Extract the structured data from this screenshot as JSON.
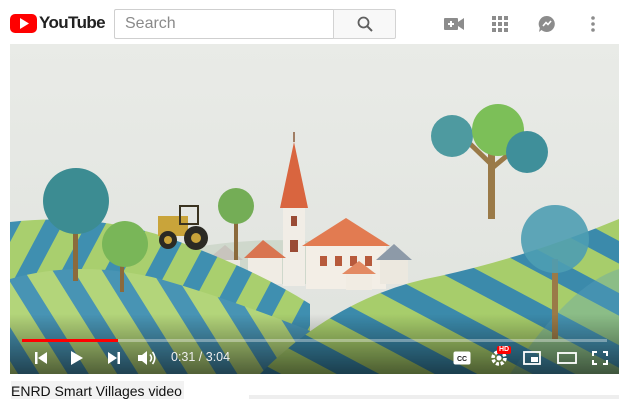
{
  "header": {
    "logo_text": "YouTube",
    "search_placeholder": "Search",
    "icons": [
      "search-icon",
      "create-video-icon",
      "apps-grid-icon",
      "messages-icon",
      "more-options-icon"
    ]
  },
  "player": {
    "progress_fraction": 0.164,
    "current_time": "0:31",
    "time_separator": "/",
    "duration": "3:04",
    "time_display": "0:31 / 3:04",
    "quality_badge": "HD",
    "icons": [
      "previous-icon",
      "play-icon",
      "next-icon",
      "volume-icon",
      "captions-icon",
      "settings-icon",
      "miniplayer-icon",
      "theater-mode-icon",
      "fullscreen-icon"
    ]
  },
  "video": {
    "title": "ENRD Smart Villages video"
  },
  "colors": {
    "brand_red": "#ff0000",
    "sky": "#e6e8e4",
    "stripe_green": "#a9cf6e",
    "stripe_blue": "#3f8fb0",
    "roof_orange": "#e07a4f"
  }
}
